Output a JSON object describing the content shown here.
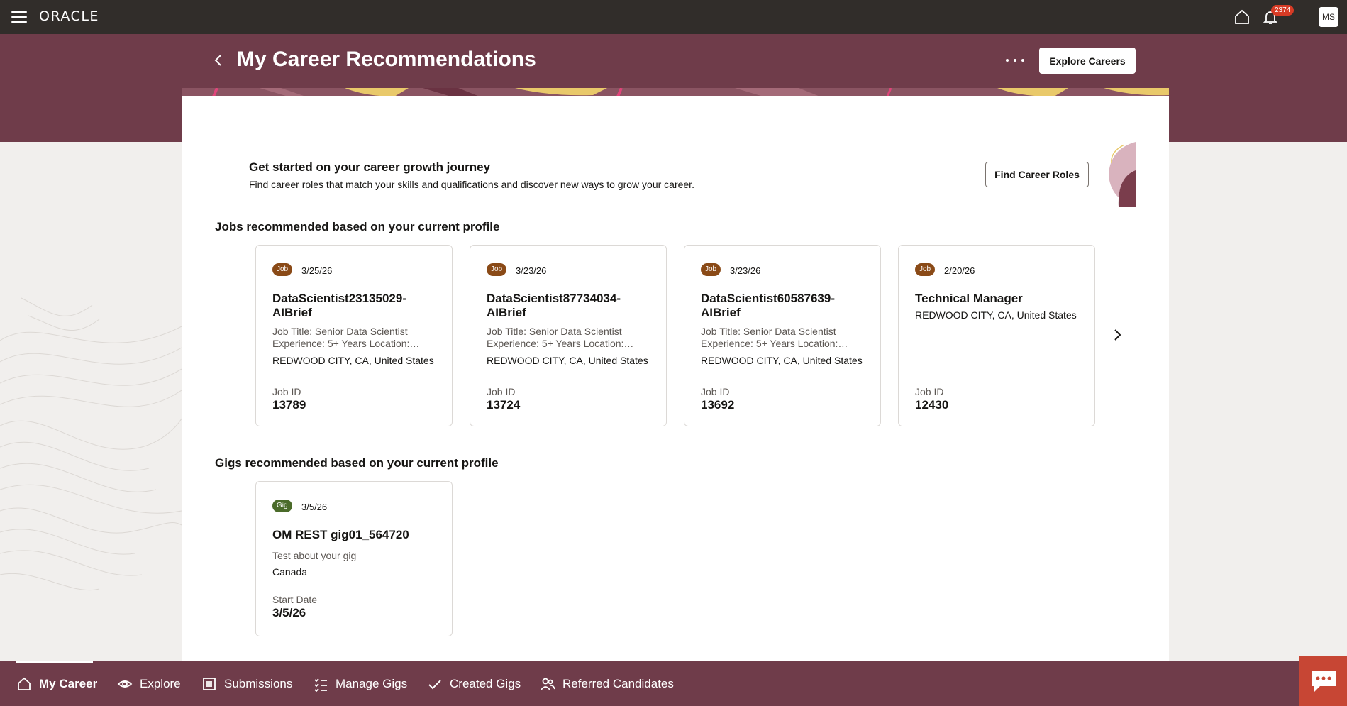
{
  "topbar": {
    "logo": "ORACLE",
    "notification_count": "2374",
    "avatar_initials": "MS"
  },
  "header": {
    "title": "My Career Recommendations",
    "explore_button": "Explore Careers"
  },
  "intro": {
    "title": "Get started on your career growth journey",
    "text": "Find career roles that match your skills and qualifications and discover new ways to grow your career.",
    "find_button": "Find Career Roles"
  },
  "jobs": {
    "section_title": "Jobs recommended based on your current profile",
    "items": [
      {
        "tag": "Job",
        "date": "3/25/26",
        "name": "DataScientist23135029-AIBrief",
        "desc": "Job Title: Senior Data Scientist Experience: 5+ Years Location:…",
        "location": "REDWOOD CITY, CA, United States",
        "id_label": "Job ID",
        "id": "13789"
      },
      {
        "tag": "Job",
        "date": "3/23/26",
        "name": "DataScientist87734034-AIBrief",
        "desc": "Job Title: Senior Data Scientist Experience: 5+ Years Location:…",
        "location": "REDWOOD CITY, CA, United States",
        "id_label": "Job ID",
        "id": "13724"
      },
      {
        "tag": "Job",
        "date": "3/23/26",
        "name": "DataScientist60587639-AIBrief",
        "desc": "Job Title: Senior Data Scientist Experience: 5+ Years Location:…",
        "location": "REDWOOD CITY, CA, United States",
        "id_label": "Job ID",
        "id": "13692"
      },
      {
        "tag": "Job",
        "date": "2/20/26",
        "name": "Technical Manager",
        "desc": "",
        "location": "REDWOOD CITY, CA, United States",
        "id_label": "Job ID",
        "id": "12430"
      }
    ]
  },
  "gigs": {
    "section_title": "Gigs recommended based on your current profile",
    "items": [
      {
        "tag": "Gig",
        "date": "3/5/26",
        "name": "OM REST gig01_564720",
        "desc": "Test about your gig",
        "location": "Canada",
        "id_label": "Start Date",
        "id": "3/5/26"
      }
    ]
  },
  "bottom_nav": [
    {
      "label": "My Career",
      "icon": "home-icon",
      "active": true
    },
    {
      "label": "Explore",
      "icon": "eye-icon"
    },
    {
      "label": "Submissions",
      "icon": "list-icon"
    },
    {
      "label": "Manage Gigs",
      "icon": "checklist-icon"
    },
    {
      "label": "Created Gigs",
      "icon": "check-icon"
    },
    {
      "label": "Referred Candidates",
      "icon": "people-icon"
    }
  ],
  "colors": {
    "topbar": "#312d2a",
    "brand_band": "#6f3c4a",
    "job_tag": "#8a4a17",
    "gig_tag": "#4b6b2a",
    "chat_button": "#c74634"
  }
}
